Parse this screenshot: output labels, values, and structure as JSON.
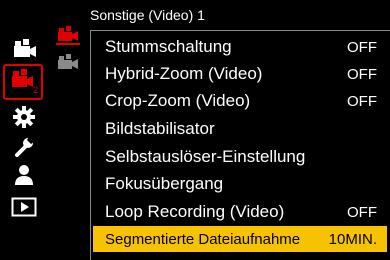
{
  "page_title": "Sonstige (Video) 1",
  "sidebar": {
    "items": [
      {
        "icon": "photo-camera-icon",
        "selected": false
      },
      {
        "icon": "video-camera-icon",
        "badge": "2",
        "selected": true
      },
      {
        "icon": "gear-icon",
        "selected": false
      },
      {
        "icon": "wrench-icon",
        "selected": false
      },
      {
        "icon": "person-icon",
        "selected": false
      },
      {
        "icon": "playback-icon",
        "selected": false
      }
    ]
  },
  "subtabs": [
    {
      "icon": "video-camera-icon",
      "selected": true
    },
    {
      "icon": "video-camera-icon",
      "selected": false
    }
  ],
  "colors": {
    "accent_red": "#e00000",
    "highlight": "#f7c300",
    "background": "#000000"
  },
  "menu": {
    "items": [
      {
        "label": "Stummschaltung",
        "value": "OFF"
      },
      {
        "label": "Hybrid-Zoom (Video)",
        "value": "OFF"
      },
      {
        "label": "Crop-Zoom (Video)",
        "value": "OFF"
      },
      {
        "label": "Bildstabilisator",
        "value": ""
      },
      {
        "label": "Selbstauslöser-Einstellung",
        "value": ""
      },
      {
        "label": "Fokusübergang",
        "value": ""
      },
      {
        "label": "Loop Recording (Video)",
        "value": "OFF"
      },
      {
        "label": "Segmentierte Dateiaufnahme",
        "value": "10MIN.",
        "selected": true
      }
    ]
  }
}
